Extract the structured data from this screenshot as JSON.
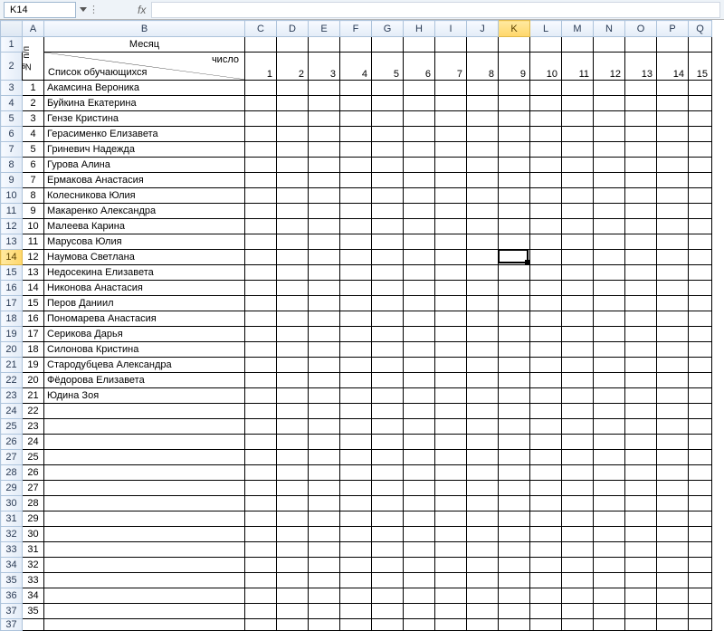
{
  "namebox": "K14",
  "fx_label": "fx",
  "colHeaders": [
    "A",
    "B",
    "C",
    "D",
    "E",
    "F",
    "G",
    "H",
    "I",
    "J",
    "K",
    "L",
    "M",
    "N",
    "O",
    "P",
    "Q"
  ],
  "selectedCol": "K",
  "selectedRow": 14,
  "row1": {
    "mesyats": "Месяц"
  },
  "row2": {
    "spisok": "Список обучающихся",
    "chislo": "число",
    "nums": [
      "1",
      "2",
      "3",
      "4",
      "5",
      "6",
      "7",
      "8",
      "9",
      "10",
      "11",
      "12",
      "13",
      "14",
      "15"
    ]
  },
  "npp_label": "№ п/п",
  "students": [
    "Акамсина Вероника",
    "Буйкина Екатерина",
    "Гензе Кристина",
    "Герасименко Елизавета",
    "Гриневич Надежда",
    "Гурова Алина",
    "Ермакова Анастасия",
    "Колесникова Юлия",
    "Макаренко Александра",
    "Малеева Карина",
    "Марусова Юлия",
    "Наумова Светлана",
    "Недосекина Елизавета",
    "Никонова Анастасия",
    "Перов Даниил",
    "Пономарева Анастасия",
    "Серикова Дарья",
    "Силонова Кристина",
    "Стародубцева Александра",
    "Фёдорова Елизавета",
    "Юдина Зоя"
  ],
  "emptyRowsStart": 22,
  "emptyRowsEnd": 36
}
